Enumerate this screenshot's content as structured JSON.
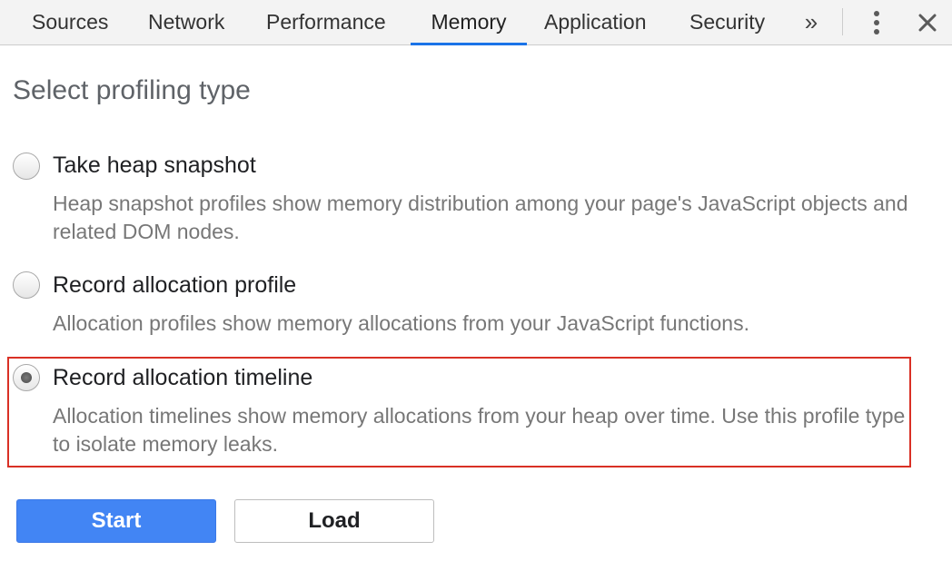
{
  "tabs": [
    {
      "label": "Sources"
    },
    {
      "label": "Network"
    },
    {
      "label": "Performance"
    },
    {
      "label": "Memory",
      "active": true
    },
    {
      "label": "Application"
    },
    {
      "label": "Security"
    }
  ],
  "toolbar": {
    "more_tabs_symbol": "»",
    "icons": [
      "more-tabs-icon",
      "kebab-menu-icon",
      "close-icon"
    ]
  },
  "main": {
    "heading": "Select profiling type",
    "options": [
      {
        "label": "Take heap snapshot",
        "description": "Heap snapshot profiles show memory distribution among your page's JavaScript objects and related DOM nodes.",
        "selected": false
      },
      {
        "label": "Record allocation profile",
        "description": "Allocation profiles show memory allocations from your JavaScript functions.",
        "selected": false
      },
      {
        "label": "Record allocation timeline",
        "description": "Allocation timelines show memory allocations from your heap over time. Use this profile type to isolate memory leaks.",
        "selected": true
      }
    ],
    "start_label": "Start",
    "load_label": "Load"
  },
  "colors": {
    "accent": "#1a73e8",
    "start_button": "#4285f4",
    "highlight_border": "#d93025"
  }
}
